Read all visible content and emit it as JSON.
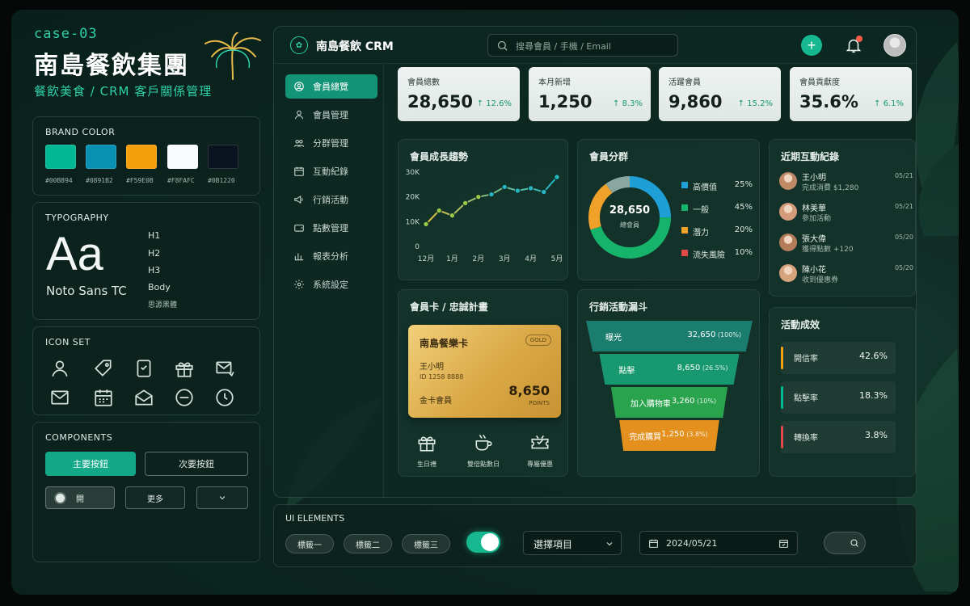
{
  "brand": {
    "case_id": "case-03",
    "title": "南島餐飲集團",
    "subtitle": "餐飲美食 / CRM 客戶關係管理"
  },
  "brand_color": {
    "title": "BRAND COLOR",
    "swatches": [
      {
        "hex": "#00B894",
        "label": "#00B894"
      },
      {
        "hex": "#0891B2",
        "label": "#0891B2"
      },
      {
        "hex": "#F59E0B",
        "label": "#F59E0B"
      },
      {
        "hex": "#F8FAFC",
        "label": "#F8FAFC"
      },
      {
        "hex": "#0B1220",
        "label": "#0B1220"
      }
    ]
  },
  "typography": {
    "title": "TYPOGRAPHY",
    "sample": "Aa",
    "font_name": "Noto Sans TC",
    "levels": [
      "H1",
      "H2",
      "H3",
      "Body",
      "思源黑體"
    ]
  },
  "icon_set": {
    "title": "ICON SET",
    "icons": [
      "user-icon",
      "tag-icon",
      "tablet-icon",
      "gift-icon",
      "mail-send-icon",
      "envelope-icon",
      "calendar-icon",
      "envelope-open-icon",
      "minus-circle-icon",
      "clock-icon"
    ]
  },
  "components": {
    "title": "COMPONENTS",
    "primary": "主要按鈕",
    "secondary": "次要按鈕",
    "radio_label": "開",
    "more": "更多"
  },
  "header": {
    "app_title": "南島餐飲 CRM",
    "search_placeholder": "搜尋會員 / 手機 / Email"
  },
  "nav": [
    {
      "label": "會員總覽",
      "icon": "user-circle-icon",
      "active": true
    },
    {
      "label": "會員管理",
      "icon": "user-icon",
      "active": false
    },
    {
      "label": "分群管理",
      "icon": "groups-icon",
      "active": false
    },
    {
      "label": "互動紀錄",
      "icon": "calendar-icon",
      "active": false
    },
    {
      "label": "行銷活動",
      "icon": "megaphone-icon",
      "active": false
    },
    {
      "label": "點數管理",
      "icon": "wallet-icon",
      "active": false
    },
    {
      "label": "報表分析",
      "icon": "bar-chart-icon",
      "active": false
    },
    {
      "label": "系統設定",
      "icon": "gear-icon",
      "active": false
    }
  ],
  "kpis": [
    {
      "label": "會員總數",
      "value": "28,650",
      "delta": "12.6%"
    },
    {
      "label": "本月新增",
      "value": "1,250",
      "delta": "8.3%"
    },
    {
      "label": "活躍會員",
      "value": "9,860",
      "delta": "15.2%"
    },
    {
      "label": "會員貢獻度",
      "value": "35.6%",
      "delta": "6.1%"
    }
  ],
  "growth": {
    "title": "會員成長趨勢"
  },
  "segments": {
    "title": "會員分群",
    "center_value": "28,650",
    "center_label": "總會員"
  },
  "activity": {
    "title": "近期互動紀錄",
    "items": [
      {
        "name": "王小明",
        "desc": "完成消費 $1,280",
        "date": "05/21",
        "color": "#c08a66"
      },
      {
        "name": "林美華",
        "desc": "參加活動",
        "date": "05/21",
        "color": "#d59b7a"
      },
      {
        "name": "張大偉",
        "desc": "獲得點數 +120",
        "date": "05/20",
        "color": "#b57c5a"
      },
      {
        "name": "陳小花",
        "desc": "收到優惠券",
        "date": "05/20",
        "color": "#d7a37d"
      }
    ]
  },
  "loyalty": {
    "title": "會員卡 / 忠誠計畫",
    "card_name": "南島餐樂卡",
    "badge": "GOLD",
    "holder": "王小明",
    "card_no": "ID 1258 8888",
    "tier": "金卡會員",
    "points": "8,650",
    "points_label": "POINTS",
    "perks": [
      {
        "label": "生日禮",
        "icon": "gift-icon"
      },
      {
        "label": "雙倍點數日",
        "icon": "coffee-cup-icon"
      },
      {
        "label": "專屬優惠",
        "icon": "ticket-icon"
      }
    ]
  },
  "funnel": {
    "title": "行銷活動漏斗"
  },
  "effectiveness": {
    "title": "活動成效",
    "items": [
      {
        "label": "開信率",
        "value": "42.6%",
        "color": "#F59E0B"
      },
      {
        "label": "點擊率",
        "value": "18.3%",
        "color": "#00B894"
      },
      {
        "label": "轉換率",
        "value": "3.8%",
        "color": "#e24a4a"
      }
    ]
  },
  "ui_elements": {
    "title": "UI ELEMENTS",
    "chips": [
      "標籤一",
      "標籤二",
      "標籤三"
    ],
    "toggle_on": true,
    "select_value": "選擇項目",
    "date_value": "2024/05/21"
  },
  "colors": {
    "accent": "#00B894",
    "up": "#159a6e"
  },
  "chart_data": [
    {
      "type": "line",
      "title": "會員成長趨勢",
      "x": [
        "12月",
        "1月",
        "2月",
        "3月",
        "4月",
        "5月"
      ],
      "ytick_labels": [
        "0",
        "10K",
        "20K",
        "30K"
      ],
      "ylim": [
        0,
        30000
      ],
      "x_points": [
        0,
        0.5,
        1,
        1.5,
        2,
        2.5,
        3,
        3.5,
        4,
        4.5,
        5
      ],
      "values": [
        9000,
        14500,
        12500,
        17500,
        20000,
        21000,
        24000,
        22500,
        23500,
        22000,
        28000
      ],
      "colors": {
        "start": "#E0C341",
        "end": "#20B8C8"
      }
    },
    {
      "type": "pie",
      "title": "會員分群",
      "categories": [
        "高價值",
        "一般",
        "潛力",
        "流失風險"
      ],
      "values": [
        25,
        45,
        20,
        10
      ],
      "labels": [
        "25%",
        "45%",
        "20%",
        "10%"
      ],
      "colors": [
        "#1E9FD6",
        "#16B36B",
        "#F0A12A",
        "#8aa6a0"
      ],
      "legend_colors": [
        "#1E9FD6",
        "#16B36B",
        "#F0A12A",
        "#E24A4A"
      ]
    },
    {
      "type": "bar",
      "title": "行銷活動漏斗",
      "categories": [
        "曝光",
        "點擊",
        "加入購物車",
        "完成購買"
      ],
      "values": [
        32650,
        8650,
        3260,
        1250
      ],
      "value_labels": [
        "32,650",
        "8,650",
        "3,260",
        "1,250"
      ],
      "percents": [
        "(100%)",
        "(26.5%)",
        "(10%)",
        "(3.8%)"
      ],
      "colors": [
        "#1b7d6d",
        "#17986f",
        "#2aa34d",
        "#e3901e"
      ]
    }
  ]
}
